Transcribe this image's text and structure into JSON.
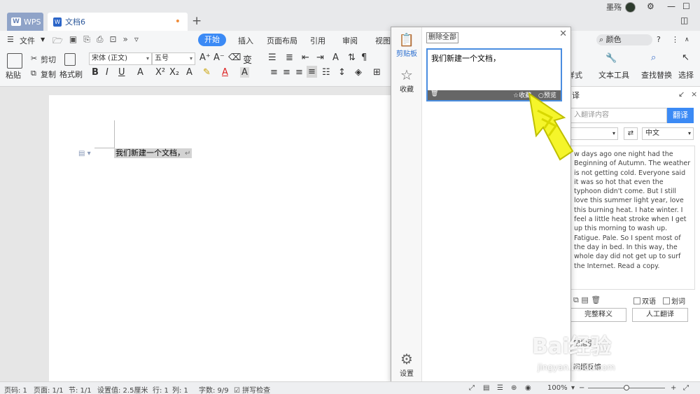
{
  "tabs": {
    "wps_label": "WPS",
    "doc_label": "文档6",
    "new_tab": "+"
  },
  "user": {
    "name": "墨殇"
  },
  "menu": {
    "file": "文件",
    "items": [
      "开始",
      "插入",
      "页面布局",
      "引用",
      "审阅",
      "视图"
    ],
    "search_placeholder": "颜色"
  },
  "ribbon": {
    "paste": "粘贴",
    "cut": "剪切",
    "copy": "复制",
    "format_painter": "格式刷",
    "font_name": "宋体 (正文)",
    "font_size": "五号",
    "text_tools": "文本工具",
    "find_replace": "查找替换",
    "select": "选择",
    "style_partial": "样式"
  },
  "document": {
    "text": "我们新建一个文档，"
  },
  "clipboard": {
    "delete_all": "删除全部",
    "nav_clipboard": "剪贴板",
    "nav_favorites": "收藏",
    "nav_settings": "设置",
    "entry_text": "我们新建一个文档，",
    "entry_fav": "收藏",
    "entry_preview": "预览"
  },
  "translate": {
    "header_partial": "译",
    "input_placeholder": "入翻译内容",
    "translate_button": "翻译",
    "target_lang": "中文",
    "text": "w days ago one night had the Beginning of Autumn. The weather is not getting cold. Everyone said it was so hot that even the typhoon didn't come. But I still love this summer light year, love this burning heat. I hate winter. I feel a little heat stroke when I get up this morning to wash up. Fatigue. Pale. So I spent most of the day in bed. In this way, the whole day did not get up to surf the Internet. Read a copy.",
    "bilingual": "双语",
    "word_select": "划词",
    "full_definition": "完整释义",
    "human_translation": "人工翻译",
    "footer_1": "用指引",
    "footer_2": "问题反馈"
  },
  "status": {
    "page_code": "页码: 1",
    "pages": "页面: 1/1",
    "section": "节: 1/1",
    "setting": "设置值: 2.5厘米",
    "row": "行: 1",
    "col": "列: 1",
    "word_count": "字数: 9/9",
    "spellcheck": "拼写检查",
    "zoom": "100%"
  },
  "watermark": {
    "main": "Bai经验",
    "sub": "jingyan.baidu.com"
  },
  "colors": {
    "accent": "#3b8af5",
    "arrow": "#f5f52a",
    "selection": "#d3d3d3"
  }
}
